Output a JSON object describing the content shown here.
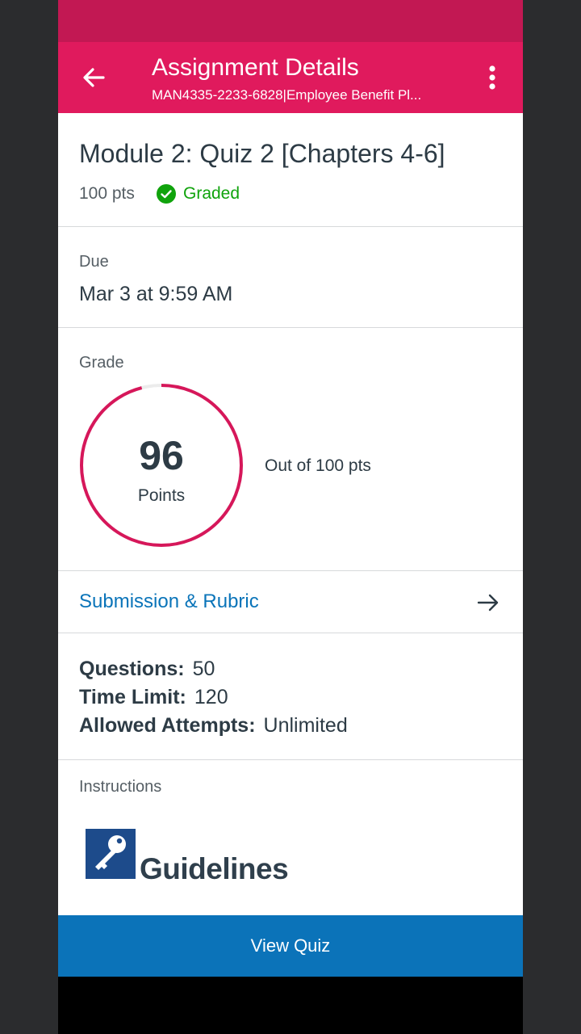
{
  "colors": {
    "statusbar": "#c21853",
    "appbar": "#e01a5d",
    "graded_green": "#10a30c",
    "link_blue": "#0a74b9",
    "button_blue": "#0b73b9",
    "ring": "#d6175a"
  },
  "appbar": {
    "title": "Assignment Details",
    "subtitle": "MAN4335-2233-6828|Employee Benefit Pl...",
    "back_icon": "arrow-left-icon",
    "more_icon": "more-vertical-icon"
  },
  "assignment": {
    "title": "Module 2: Quiz 2 [Chapters 4-6]",
    "points": "100 pts",
    "status": "Graded",
    "status_icon": "check-circle-icon"
  },
  "due": {
    "label": "Due",
    "value": "Mar 3 at 9:59 AM"
  },
  "grade": {
    "label": "Grade",
    "score": "96",
    "score_unit": "Points",
    "out_of": "Out of 100 pts",
    "fraction": 0.96
  },
  "submission": {
    "label": "Submission & Rubric",
    "icon": "arrow-right-icon"
  },
  "details": {
    "questions_label": "Questions:",
    "questions_value": "50",
    "time_limit_label": "Time Limit:",
    "time_limit_value": "120",
    "attempts_label": "Allowed Attempts:",
    "attempts_value": "Unlimited"
  },
  "instructions": {
    "label": "Instructions",
    "logo_icon": "key-icon",
    "heading": "Guidelines"
  },
  "footer": {
    "button_label": "View Quiz"
  }
}
